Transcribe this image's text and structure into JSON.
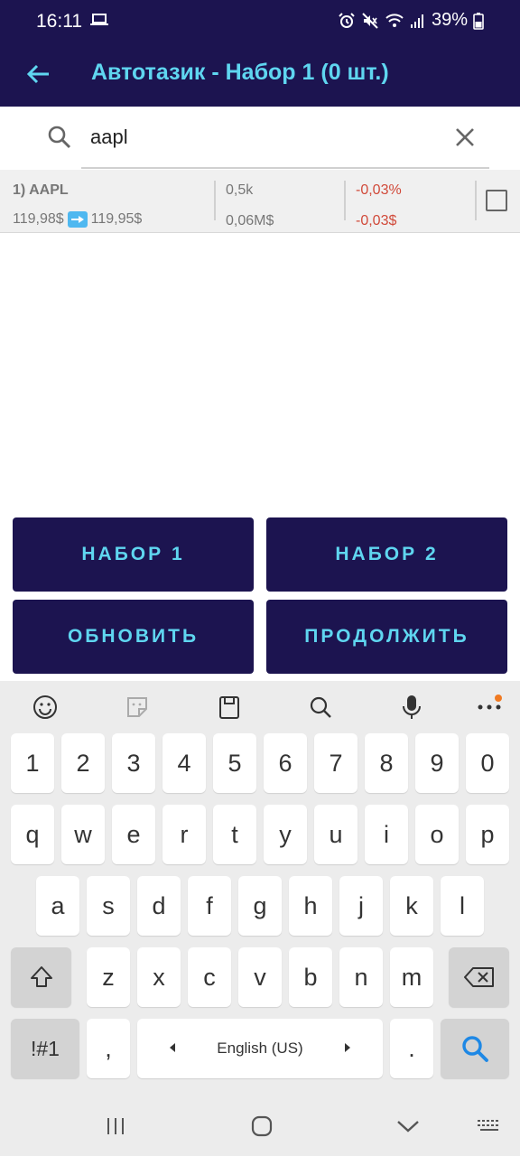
{
  "status_bar": {
    "time": "16:11",
    "battery": "39%"
  },
  "app_bar": {
    "title": "Автотазик - Набор 1 (0 шт.)"
  },
  "search": {
    "value": "aapl"
  },
  "result": {
    "ticker": "1) AAPL",
    "price_from": "119,98$",
    "price_to": "119,95$",
    "volume": "0,5k",
    "turnover": "0,06M$",
    "change_pct": "-0,03%",
    "change_abs": "-0,03$",
    "change_color": "#d14a3a"
  },
  "buttons": {
    "set1": "НАБОР 1",
    "set2": "НАБОР 2",
    "refresh": "ОБНОВИТЬ",
    "continue": "ПРОДОЛЖИТЬ"
  },
  "keyboard": {
    "row_digits": [
      "1",
      "2",
      "3",
      "4",
      "5",
      "6",
      "7",
      "8",
      "9",
      "0"
    ],
    "row_top": [
      "q",
      "w",
      "e",
      "r",
      "t",
      "y",
      "u",
      "i",
      "o",
      "p"
    ],
    "row_mid": [
      "a",
      "s",
      "d",
      "f",
      "g",
      "h",
      "j",
      "k",
      "l"
    ],
    "row_bottom": [
      "z",
      "x",
      "c",
      "v",
      "b",
      "n",
      "m"
    ],
    "symbols": "!#1",
    "comma": ",",
    "space": "English (US)",
    "period": "."
  },
  "colors": {
    "app_bar": "#1c1450",
    "accent": "#5fd6f0",
    "negative": "#d14a3a",
    "search_key": "#1e88e5"
  }
}
